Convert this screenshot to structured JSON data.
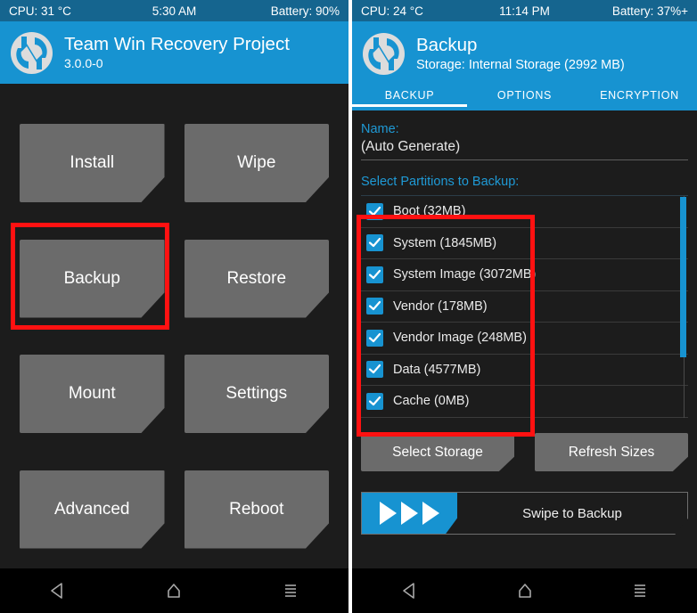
{
  "left": {
    "statusbar": {
      "cpu": "CPU: 31 °C",
      "time": "5:30 AM",
      "battery": "Battery: 90%"
    },
    "header": {
      "title": "Team Win Recovery Project",
      "version": "3.0.0-0",
      "logo_icon": "twrp-logo-icon"
    },
    "menu": [
      {
        "label": "Install"
      },
      {
        "label": "Wipe"
      },
      {
        "label": "Backup"
      },
      {
        "label": "Restore"
      },
      {
        "label": "Mount"
      },
      {
        "label": "Settings"
      },
      {
        "label": "Advanced"
      },
      {
        "label": "Reboot"
      }
    ],
    "highlight": {
      "target": "Backup",
      "color": "#ff1111"
    },
    "navbar": {
      "back_icon": "back-triangle-icon",
      "home_icon": "home-icon",
      "menu_icon": "hamburger-menu-icon"
    }
  },
  "right": {
    "statusbar": {
      "cpu": "CPU: 24 °C",
      "time": "11:14 PM",
      "battery": "Battery: 37%+"
    },
    "header": {
      "title": "Backup",
      "subtitle": "Storage: Internal Storage (2992 MB)",
      "logo_icon": "twrp-logo-icon"
    },
    "tabs": [
      {
        "label": "BACKUP",
        "active": true
      },
      {
        "label": "OPTIONS",
        "active": false
      },
      {
        "label": "ENCRYPTION",
        "active": false
      }
    ],
    "name_field": {
      "label": "Name:",
      "value": "(Auto Generate)"
    },
    "partitions_label": "Select Partitions to Backup:",
    "partitions": [
      {
        "label": "Boot (32MB)",
        "checked": true
      },
      {
        "label": "System (1845MB)",
        "checked": true
      },
      {
        "label": "System Image (3072MB)",
        "checked": true
      },
      {
        "label": "Vendor (178MB)",
        "checked": true
      },
      {
        "label": "Vendor Image (248MB)",
        "checked": true
      },
      {
        "label": "Data (4577MB)",
        "checked": true
      },
      {
        "label": "Cache (0MB)",
        "checked": true
      }
    ],
    "buttons": {
      "select_storage": "Select Storage",
      "refresh_sizes": "Refresh Sizes"
    },
    "swipe": {
      "label": "Swipe to Backup",
      "arrow_icon": "play-triangle-icon"
    },
    "highlight": {
      "target": "partition-list",
      "color": "#ff1111"
    },
    "navbar": {
      "back_icon": "back-triangle-icon",
      "home_icon": "home-icon",
      "menu_icon": "hamburger-menu-icon"
    }
  },
  "colors": {
    "accent": "#1793d1",
    "statusbar": "#15658f",
    "background": "#1c1c1c",
    "button": "#6b6b6b",
    "highlight": "#ff1111"
  }
}
